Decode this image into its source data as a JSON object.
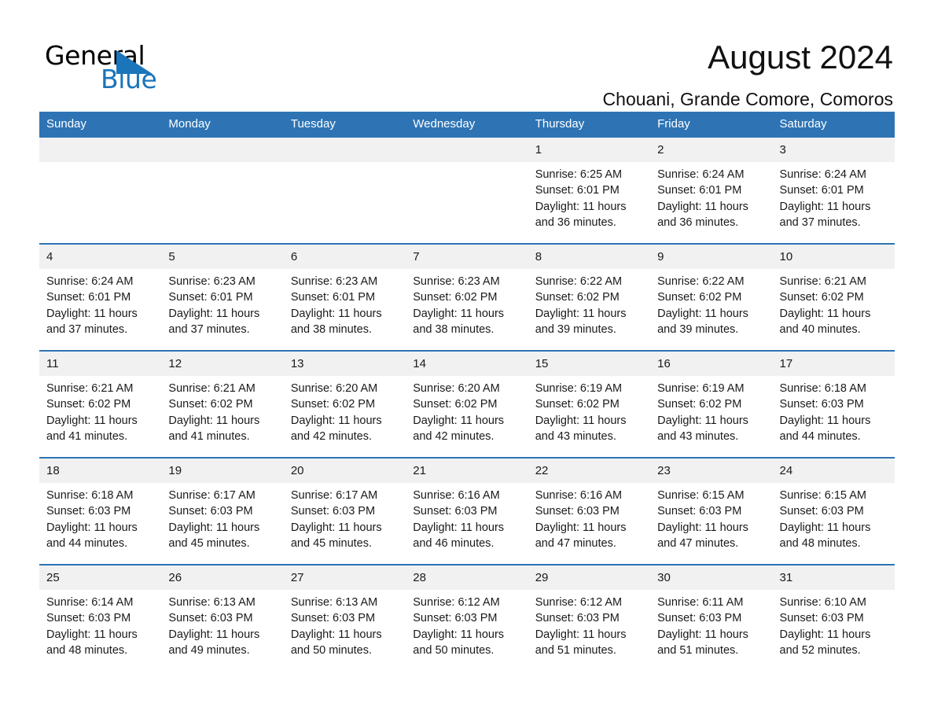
{
  "logo": {
    "word1": "General",
    "word2": "Blue",
    "triangle_color": "#1b75bb"
  },
  "header": {
    "month_title": "August 2024",
    "location": "Chouani, Grande Comore, Comoros"
  },
  "theme": {
    "header_blue": "#2e74b5",
    "date_band_gray": "#f1f1f1",
    "text": "#1a1a1a"
  },
  "calendar": {
    "weekday_headers": [
      "Sunday",
      "Monday",
      "Tuesday",
      "Wednesday",
      "Thursday",
      "Friday",
      "Saturday"
    ],
    "weeks": [
      [
        {
          "date": "",
          "blank": true
        },
        {
          "date": "",
          "blank": true
        },
        {
          "date": "",
          "blank": true
        },
        {
          "date": "",
          "blank": true
        },
        {
          "date": "1",
          "sunrise": "Sunrise: 6:25 AM",
          "sunset": "Sunset: 6:01 PM",
          "daylight_1": "Daylight: 11 hours",
          "daylight_2": "and 36 minutes."
        },
        {
          "date": "2",
          "sunrise": "Sunrise: 6:24 AM",
          "sunset": "Sunset: 6:01 PM",
          "daylight_1": "Daylight: 11 hours",
          "daylight_2": "and 36 minutes."
        },
        {
          "date": "3",
          "sunrise": "Sunrise: 6:24 AM",
          "sunset": "Sunset: 6:01 PM",
          "daylight_1": "Daylight: 11 hours",
          "daylight_2": "and 37 minutes."
        }
      ],
      [
        {
          "date": "4",
          "sunrise": "Sunrise: 6:24 AM",
          "sunset": "Sunset: 6:01 PM",
          "daylight_1": "Daylight: 11 hours",
          "daylight_2": "and 37 minutes."
        },
        {
          "date": "5",
          "sunrise": "Sunrise: 6:23 AM",
          "sunset": "Sunset: 6:01 PM",
          "daylight_1": "Daylight: 11 hours",
          "daylight_2": "and 37 minutes."
        },
        {
          "date": "6",
          "sunrise": "Sunrise: 6:23 AM",
          "sunset": "Sunset: 6:01 PM",
          "daylight_1": "Daylight: 11 hours",
          "daylight_2": "and 38 minutes."
        },
        {
          "date": "7",
          "sunrise": "Sunrise: 6:23 AM",
          "sunset": "Sunset: 6:02 PM",
          "daylight_1": "Daylight: 11 hours",
          "daylight_2": "and 38 minutes."
        },
        {
          "date": "8",
          "sunrise": "Sunrise: 6:22 AM",
          "sunset": "Sunset: 6:02 PM",
          "daylight_1": "Daylight: 11 hours",
          "daylight_2": "and 39 minutes."
        },
        {
          "date": "9",
          "sunrise": "Sunrise: 6:22 AM",
          "sunset": "Sunset: 6:02 PM",
          "daylight_1": "Daylight: 11 hours",
          "daylight_2": "and 39 minutes."
        },
        {
          "date": "10",
          "sunrise": "Sunrise: 6:21 AM",
          "sunset": "Sunset: 6:02 PM",
          "daylight_1": "Daylight: 11 hours",
          "daylight_2": "and 40 minutes."
        }
      ],
      [
        {
          "date": "11",
          "sunrise": "Sunrise: 6:21 AM",
          "sunset": "Sunset: 6:02 PM",
          "daylight_1": "Daylight: 11 hours",
          "daylight_2": "and 41 minutes."
        },
        {
          "date": "12",
          "sunrise": "Sunrise: 6:21 AM",
          "sunset": "Sunset: 6:02 PM",
          "daylight_1": "Daylight: 11 hours",
          "daylight_2": "and 41 minutes."
        },
        {
          "date": "13",
          "sunrise": "Sunrise: 6:20 AM",
          "sunset": "Sunset: 6:02 PM",
          "daylight_1": "Daylight: 11 hours",
          "daylight_2": "and 42 minutes."
        },
        {
          "date": "14",
          "sunrise": "Sunrise: 6:20 AM",
          "sunset": "Sunset: 6:02 PM",
          "daylight_1": "Daylight: 11 hours",
          "daylight_2": "and 42 minutes."
        },
        {
          "date": "15",
          "sunrise": "Sunrise: 6:19 AM",
          "sunset": "Sunset: 6:02 PM",
          "daylight_1": "Daylight: 11 hours",
          "daylight_2": "and 43 minutes."
        },
        {
          "date": "16",
          "sunrise": "Sunrise: 6:19 AM",
          "sunset": "Sunset: 6:02 PM",
          "daylight_1": "Daylight: 11 hours",
          "daylight_2": "and 43 minutes."
        },
        {
          "date": "17",
          "sunrise": "Sunrise: 6:18 AM",
          "sunset": "Sunset: 6:03 PM",
          "daylight_1": "Daylight: 11 hours",
          "daylight_2": "and 44 minutes."
        }
      ],
      [
        {
          "date": "18",
          "sunrise": "Sunrise: 6:18 AM",
          "sunset": "Sunset: 6:03 PM",
          "daylight_1": "Daylight: 11 hours",
          "daylight_2": "and 44 minutes."
        },
        {
          "date": "19",
          "sunrise": "Sunrise: 6:17 AM",
          "sunset": "Sunset: 6:03 PM",
          "daylight_1": "Daylight: 11 hours",
          "daylight_2": "and 45 minutes."
        },
        {
          "date": "20",
          "sunrise": "Sunrise: 6:17 AM",
          "sunset": "Sunset: 6:03 PM",
          "daylight_1": "Daylight: 11 hours",
          "daylight_2": "and 45 minutes."
        },
        {
          "date": "21",
          "sunrise": "Sunrise: 6:16 AM",
          "sunset": "Sunset: 6:03 PM",
          "daylight_1": "Daylight: 11 hours",
          "daylight_2": "and 46 minutes."
        },
        {
          "date": "22",
          "sunrise": "Sunrise: 6:16 AM",
          "sunset": "Sunset: 6:03 PM",
          "daylight_1": "Daylight: 11 hours",
          "daylight_2": "and 47 minutes."
        },
        {
          "date": "23",
          "sunrise": "Sunrise: 6:15 AM",
          "sunset": "Sunset: 6:03 PM",
          "daylight_1": "Daylight: 11 hours",
          "daylight_2": "and 47 minutes."
        },
        {
          "date": "24",
          "sunrise": "Sunrise: 6:15 AM",
          "sunset": "Sunset: 6:03 PM",
          "daylight_1": "Daylight: 11 hours",
          "daylight_2": "and 48 minutes."
        }
      ],
      [
        {
          "date": "25",
          "sunrise": "Sunrise: 6:14 AM",
          "sunset": "Sunset: 6:03 PM",
          "daylight_1": "Daylight: 11 hours",
          "daylight_2": "and 48 minutes."
        },
        {
          "date": "26",
          "sunrise": "Sunrise: 6:13 AM",
          "sunset": "Sunset: 6:03 PM",
          "daylight_1": "Daylight: 11 hours",
          "daylight_2": "and 49 minutes."
        },
        {
          "date": "27",
          "sunrise": "Sunrise: 6:13 AM",
          "sunset": "Sunset: 6:03 PM",
          "daylight_1": "Daylight: 11 hours",
          "daylight_2": "and 50 minutes."
        },
        {
          "date": "28",
          "sunrise": "Sunrise: 6:12 AM",
          "sunset": "Sunset: 6:03 PM",
          "daylight_1": "Daylight: 11 hours",
          "daylight_2": "and 50 minutes."
        },
        {
          "date": "29",
          "sunrise": "Sunrise: 6:12 AM",
          "sunset": "Sunset: 6:03 PM",
          "daylight_1": "Daylight: 11 hours",
          "daylight_2": "and 51 minutes."
        },
        {
          "date": "30",
          "sunrise": "Sunrise: 6:11 AM",
          "sunset": "Sunset: 6:03 PM",
          "daylight_1": "Daylight: 11 hours",
          "daylight_2": "and 51 minutes."
        },
        {
          "date": "31",
          "sunrise": "Sunrise: 6:10 AM",
          "sunset": "Sunset: 6:03 PM",
          "daylight_1": "Daylight: 11 hours",
          "daylight_2": "and 52 minutes."
        }
      ]
    ]
  }
}
